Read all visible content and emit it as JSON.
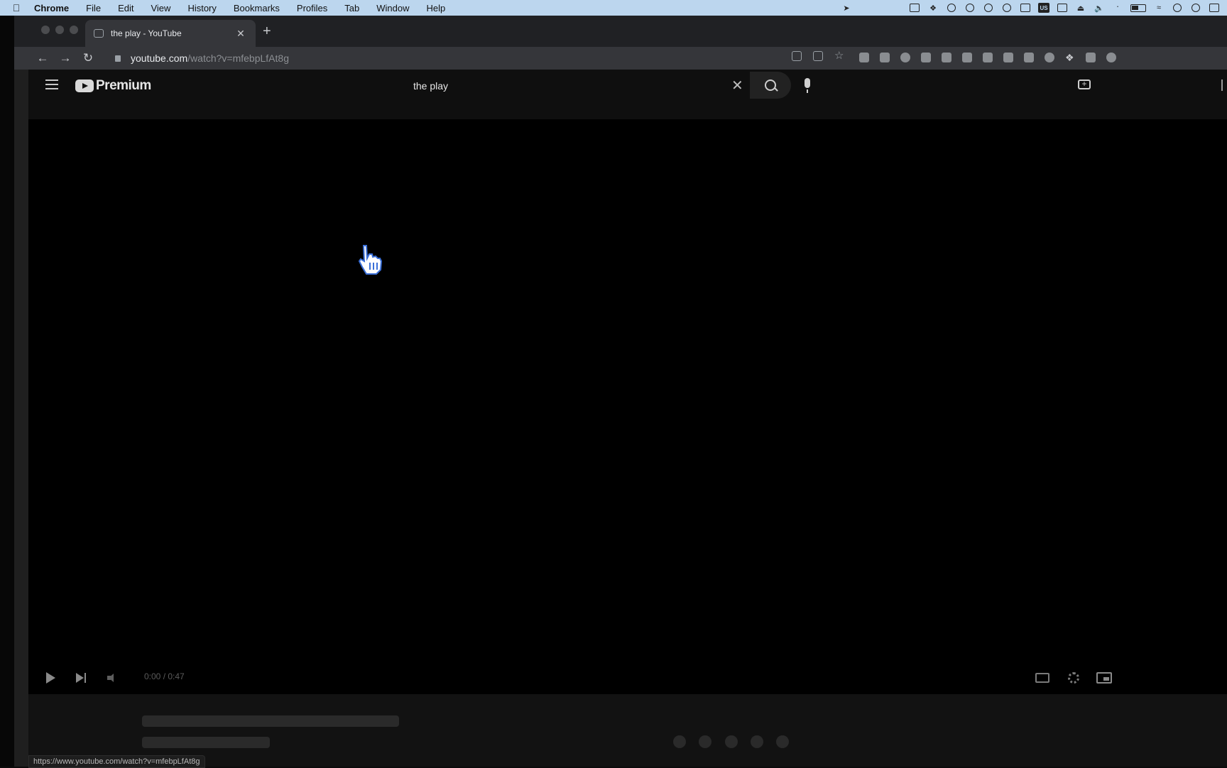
{
  "menubar": {
    "app_name": "Chrome",
    "items": [
      "File",
      "Edit",
      "View",
      "History",
      "Bookmarks",
      "Profiles",
      "Tab",
      "Window",
      "Help"
    ],
    "tray_badge": "US"
  },
  "browser": {
    "tab_title": "the play - YouTube",
    "url_host": "youtube.com",
    "url_path": "/watch?v=mfebpLfAt8g"
  },
  "youtube": {
    "brand": "Premium",
    "search_value": "the play"
  },
  "player": {
    "time_display": "0:00 / 0:47"
  },
  "status_bar": {
    "link_url": "https://www.youtube.com/watch?v=mfebpLfAt8g"
  }
}
